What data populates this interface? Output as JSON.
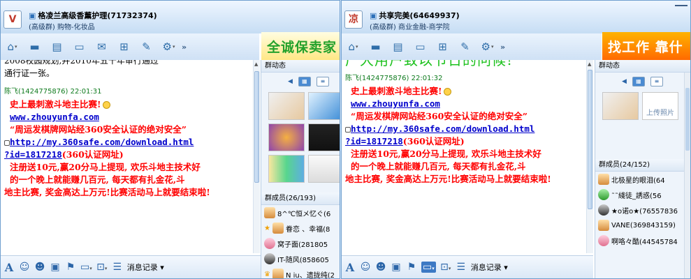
{
  "windows": [
    {
      "title": "格凌兰高级香薰护理(71732374)",
      "subtitle": "(高级群) 购物-化妆品",
      "avatar_text": "V",
      "banner": "全诚保卖家",
      "chat": {
        "prev_line_1": "2008校园规划,并2010年五十年审行通过",
        "prev_line_2": "通行证一张。",
        "sender": "陈飞(1424775876)  22:01:31",
        "lines": [
          "史上最刺激斗地主比赛!",
          "www.zhouyunfa.com",
          "“周运发棋牌网站经360安全认证的绝对安全”",
          "http://my.360safe.com/download.html",
          "?id=1817218",
          "(360认证网址)",
          "注册送10元,赢20分马上提现, 欢乐斗地主技术好",
          "的一个晚上就能赚几百元,  每天都有扎金花,斗",
          "地主比赛,  奖金高达上万元!比赛活动马上就要结束啦!"
        ]
      },
      "input_bar": {
        "history_label": "消息记录"
      },
      "side": {
        "group_dynamics": "群动态",
        "members_header": "群成员(26/193)",
        "members": [
          "8^℃恒メ忆ぐ(6",
          "眷恋 、幸福(8",
          "窝子面(281805",
          "IT-随风(858605",
          "N iu、遗拢纯(2"
        ]
      }
    },
    {
      "title": "共享完美(64649937)",
      "subtitle": "(高级群) 商业金融-商学院",
      "avatar_text": "凉",
      "banner": "找工作 靠什",
      "chat": {
        "prev_line_1": "广大用户致以节日的问候!",
        "sender": "陈飞(1424775876)  22:01:32",
        "lines": [
          "史上最刺激斗地主比赛!",
          "www.zhouyunfa.com",
          "“周运发棋牌网站经360安全认证的绝对安全”",
          "http://my.360safe.com/download.html",
          "?id=1817218",
          "(360认证网址)",
          "注册送10元,赢20分马上提现, 欢乐斗地主技术好",
          "的一个晚上就能赚几百元,  每天都有扎金花,斗",
          "地主比赛,  奖金高达上万元!比赛活动马上就要结束啦!"
        ]
      },
      "input_bar": {
        "history_label": "消息记录"
      },
      "side": {
        "group_dynamics": "群动态",
        "upload_label": "上传照片",
        "members_header": "群成员(24/152)",
        "members": [
          "北极星的眼泪(64",
          "˜˜綫徒_誘惑(56",
          "★o诺o★(76557836",
          "VANE(369843159)",
          "啊咯々酷(44545784"
        ]
      }
    }
  ],
  "icons": {
    "toolbar": [
      "home-icon",
      "folder-icon",
      "file-icon",
      "window-icon",
      "mail-icon",
      "chat-icon",
      "tools-icon",
      "settings-icon"
    ],
    "input_bar": [
      "font-icon",
      "smiley-icon",
      "face-icon",
      "picture-icon",
      "send-file-icon",
      "screenshot-icon",
      "more-icon",
      "history-icon"
    ]
  }
}
